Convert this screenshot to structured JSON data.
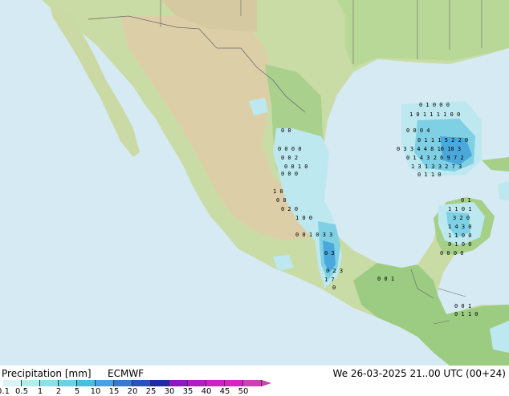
{
  "title": {
    "label": "Precipitation [mm]",
    "model": "ECMWF",
    "valid": "We 26-03-2025 21..00 UTC (00+24)"
  },
  "legend": {
    "ticks": [
      "0.1",
      "0.5",
      "1",
      "2",
      "5",
      "10",
      "15",
      "20",
      "25",
      "30",
      "35",
      "40",
      "45",
      "50"
    ],
    "colors": [
      "#d8f4f4",
      "#b4ecec",
      "#8ee0e6",
      "#6ad2e0",
      "#46c2d8",
      "#4aa0e0",
      "#3a78d2",
      "#2a50c4",
      "#1e2aa8",
      "#8a18c8",
      "#b41ac8",
      "#d21ec8",
      "#e020c0",
      "#d040b0"
    ]
  },
  "map": {
    "colors": {
      "ocean": "#d6eaf4",
      "lowland": "#a8d08a",
      "highland": "#d8ceac",
      "mountain": "#c8b890",
      "border": "#6a6a6a",
      "precip_light": "#bde8ef",
      "precip_mid": "#7fd0e4",
      "precip_heavy": "#4aa8dc"
    },
    "point_values": {
      "gulf_east": [
        "0 1 0 0 0",
        "1 0 1 1 1 1 0 0",
        "0 0 0 4",
        "0 1 1 1 5 2 2 0",
        "0 3 3 4 4 8 10 10 3",
        "0 1 4 3 2 6 9 7 2",
        "1 3 1 3 3 2 7 3",
        "0 1 1 0"
      ],
      "mexico_east": [
        "0 0",
        "0 0 0 0",
        "0 0 2",
        "0 0 1 0",
        "0 0 0",
        "1 0",
        "0 0",
        "0 2 0",
        "1 0 0",
        "0 0 1 0 3 3",
        "0 3",
        "0 2 3",
        "1 7",
        "0"
      ],
      "yucatan": [
        "0 1",
        "1 1 0 1",
        "3 2 0",
        "1 4 3 0",
        "1 1 0 0",
        "0 1 0 0",
        "0 0 0 0"
      ],
      "central_america": [
        "0 0 1",
        "0 0 1",
        "0 1 1 0"
      ]
    }
  }
}
